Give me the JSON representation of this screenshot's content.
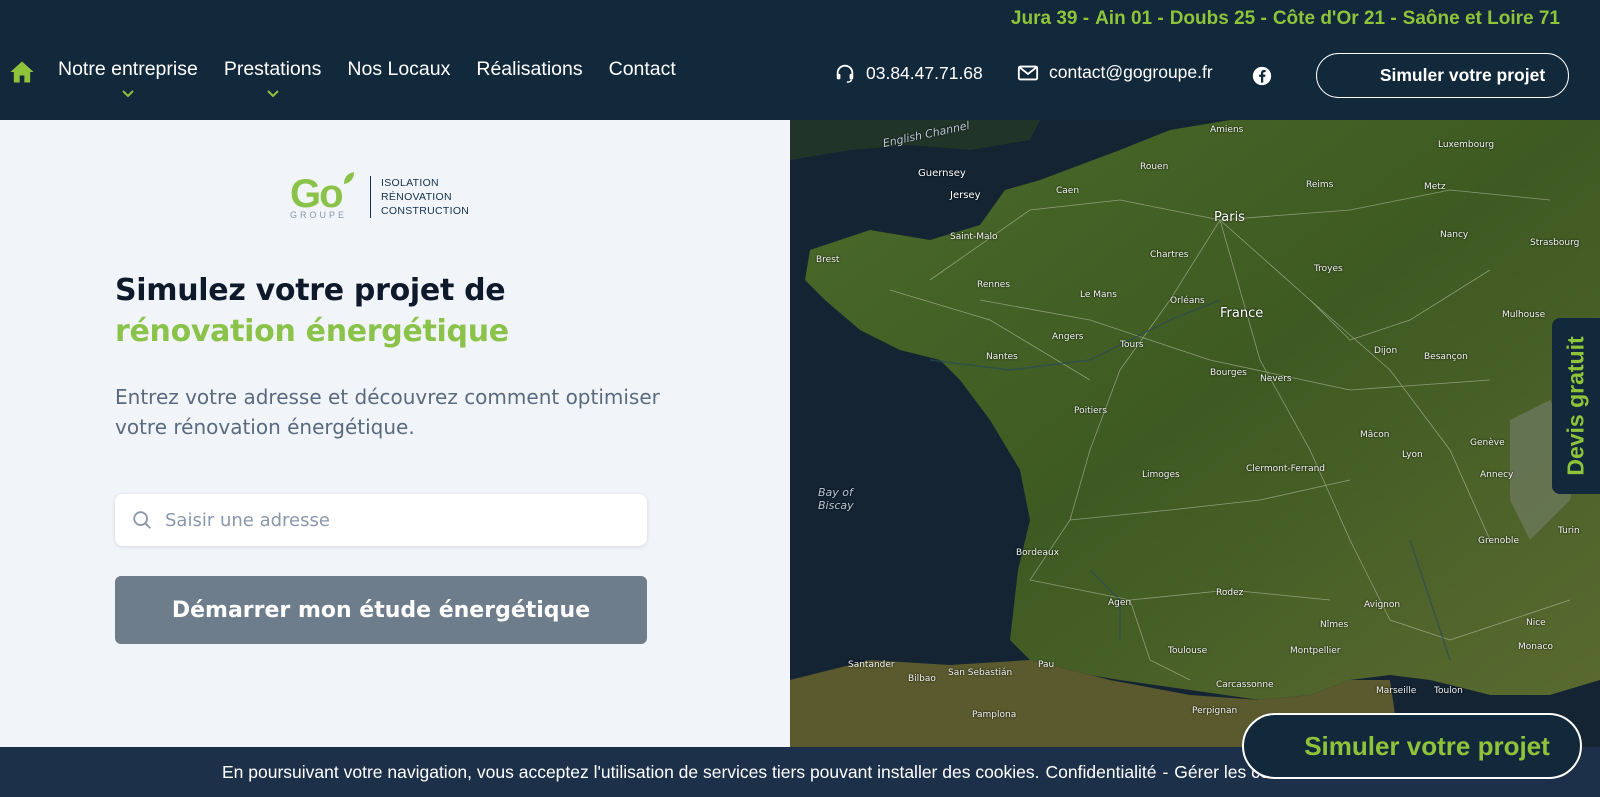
{
  "header": {
    "regions": [
      "Jura 39 -",
      "Ain 01 -",
      "Doubs 25 -",
      "Côte d'Or 21 -",
      "Saône et Loire 71"
    ],
    "nav": [
      "Notre entreprise",
      "Prestations",
      "Nos Locaux",
      "Réalisations",
      "Contact"
    ],
    "phone": "03.84.47.71.68",
    "email": "contact@gogroupe.fr",
    "cta": "Simuler votre projet"
  },
  "logo": {
    "brand": "Go",
    "sub": "GROUPE",
    "lines": [
      "ISOLATION",
      "RÉNOVATION",
      "CONSTRUCTION"
    ]
  },
  "hero": {
    "title_line1": "Simulez votre projet de",
    "title_line2": "rénovation énergétique",
    "lead": "Entrez votre adresse et découvrez comment optimiser votre rénovation énergétique.",
    "search_placeholder": "Saisir une adresse",
    "start_button": "Démarrer mon étude énergétique"
  },
  "map": {
    "labels": [
      "English Channel",
      "Guernsey",
      "Jersey",
      "Saint-Malo",
      "Brest",
      "Rennes",
      "Caen",
      "Rouen",
      "Amiens",
      "Paris",
      "Reims",
      "Metz",
      "Luxembourg",
      "Strasbourg",
      "Orléans",
      "France",
      "Tours",
      "Nantes",
      "Angers",
      "Dijon",
      "Besançon",
      "Poitiers",
      "Limoges",
      "Clermont-Ferrand",
      "Lyon",
      "Genève",
      "Bay of Biscay",
      "Bordeaux",
      "Toulouse",
      "Montpellier",
      "Marseille",
      "Toulon",
      "Nice",
      "Monaco",
      "Grenoble",
      "Turin",
      "Santander",
      "Bilbao",
      "San Sebastián",
      "Pamplona",
      "Perpignan",
      "Le Mans",
      "Chartres",
      "Troyes",
      "Nancy",
      "Mulhouse",
      "Bourges",
      "Nevers",
      "Mâcon",
      "Annecy",
      "Avignon",
      "Nîmes",
      "Rodez",
      "Agen",
      "Pau",
      "Carcassonne"
    ],
    "colors": {
      "land": "#3f5a24",
      "sea": "#142433"
    }
  },
  "devis_tab": "Devis gratuit",
  "cookie": {
    "text": "En poursuivant votre navigation, vous acceptez l'utilisation de services tiers pouvant installer des cookies.",
    "link1": "Confidentialité",
    "separator": "-",
    "link2": "Gérer les cookies"
  },
  "floating_cta": "Simuler votre projet",
  "colors": {
    "navy": "#12283b",
    "accent": "#8fc43a",
    "button_grey": "#6e7d8b",
    "panel_bg": "#f1f5f9"
  }
}
